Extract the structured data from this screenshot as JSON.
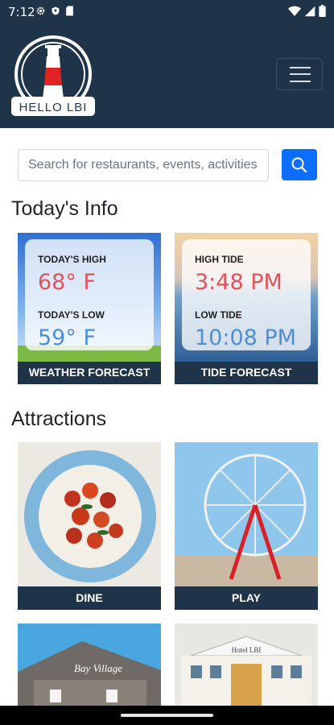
{
  "status": {
    "time": "7:12"
  },
  "brand": {
    "logo_text": "HELLO LBI"
  },
  "search": {
    "placeholder": "Search for restaurants, events, activities..."
  },
  "sections": {
    "info_title": "Today's Info",
    "attractions_title": "Attractions"
  },
  "weather": {
    "high_label": "TODAY'S HIGH",
    "high_value": "68° F",
    "low_label": "TODAY'S LOW",
    "low_value": "59° F",
    "card_label": "WEATHER FORECAST"
  },
  "tide": {
    "high_label": "HIGH TIDE",
    "high_value": "3:48 PM",
    "low_label": "LOW TIDE",
    "low_value": "10:08 PM",
    "card_label": "TIDE FORECAST"
  },
  "attractions": [
    {
      "label": "DINE"
    },
    {
      "label": "PLAY"
    },
    {
      "label": ""
    },
    {
      "label": ""
    }
  ],
  "photo_signs": {
    "bay_village": "Bay Village",
    "hotel": "Hotel LBI"
  },
  "colors": {
    "navbar": "#1f3448",
    "accent": "#0d6efd",
    "temp_high": "#e0525b",
    "temp_low": "#4d8fd6"
  }
}
